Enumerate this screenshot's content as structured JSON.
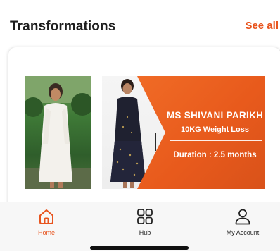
{
  "section": {
    "title": "Transformations",
    "see_all": "See all"
  },
  "banner": {
    "name": "MS SHIVANI PARIKH",
    "result": "10KG Weight Loss",
    "duration": "Duration : 2.5 months"
  },
  "nav": {
    "items": [
      {
        "label": "Home",
        "icon": "home-icon",
        "active": true
      },
      {
        "label": "Hub",
        "icon": "grid-icon",
        "active": false
      },
      {
        "label": "My Account",
        "icon": "user-icon",
        "active": false
      }
    ]
  },
  "colors": {
    "accent": "#e8541e",
    "text": "#1e1e1e",
    "nav_bg": "#f7f7f7"
  }
}
